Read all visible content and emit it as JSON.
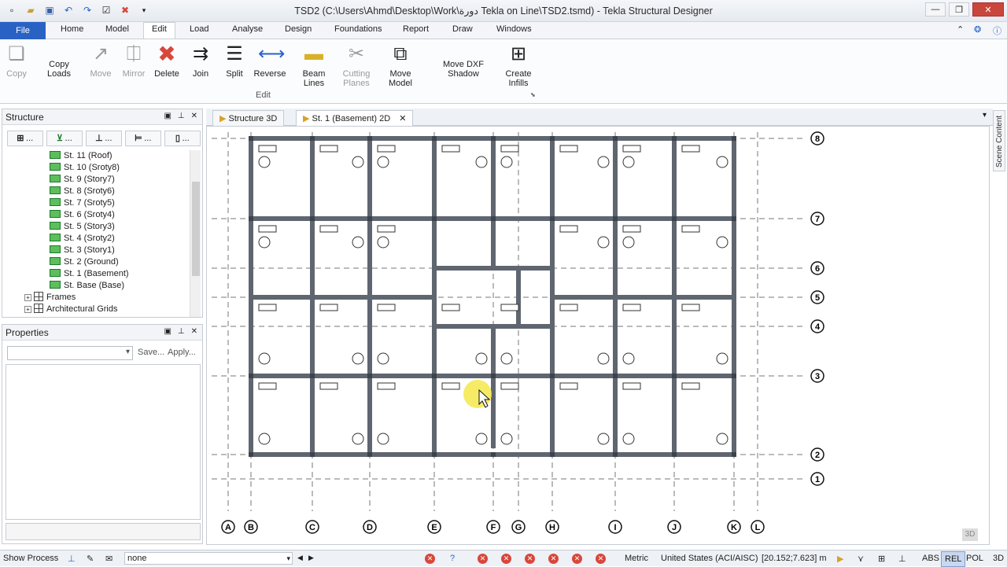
{
  "window": {
    "title": "TSD2 (C:\\Users\\Ahmd\\Desktop\\Work\\دورة Tekla on Line\\TSD2.tsmd) - Tekla Structural Designer"
  },
  "menu": {
    "file": "File",
    "tabs": [
      "Home",
      "Model",
      "Edit",
      "Load",
      "Analyse",
      "Design",
      "Foundations",
      "Report",
      "Draw",
      "Windows"
    ],
    "active_tab": "Edit"
  },
  "ribbon": {
    "copy": "Copy",
    "copy_loads": "Copy Loads",
    "move": "Move",
    "mirror": "Mirror",
    "delete": "Delete",
    "join": "Join",
    "split": "Split",
    "reverse": "Reverse",
    "beam_lines": "Beam Lines",
    "cutting_planes_1": "Cutting",
    "cutting_planes_2": "Planes",
    "move_model": "Move Model",
    "move_dxf_shadow": "Move DXF Shadow",
    "create_infills_1": "Create",
    "create_infills_2": "Infills",
    "group_label": "Edit"
  },
  "structure_panel": {
    "title": "Structure",
    "tree": [
      "St. 11 (Roof)",
      "St. 10 (Sroty8)",
      "St. 9 (Story7)",
      "St. 8 (Sroty6)",
      "St. 7 (Sroty5)",
      "St. 6 (Sroty4)",
      "St. 5 (Story3)",
      "St. 4 (Sroty2)",
      "St. 3 (Story1)",
      "St. 2 (Ground)",
      "St. 1 (Basement)",
      "St. Base (Base)"
    ],
    "frames": "Frames",
    "arch_grids": "Architectural Grids",
    "tab_more": "..."
  },
  "properties_panel": {
    "title": "Properties",
    "save": "Save...",
    "apply": "Apply..."
  },
  "doc_tabs": {
    "tab1": "Structure 3D",
    "tab2": "St. 1 (Basement) 2D"
  },
  "scene_content": "Scene Content",
  "grids": {
    "cols": [
      "A",
      "B",
      "C",
      "D",
      "E",
      "F",
      "G",
      "H",
      "I",
      "J",
      "K",
      "L"
    ],
    "rows": [
      "8",
      "7",
      "6",
      "5",
      "4",
      "3",
      "2",
      "1"
    ]
  },
  "status": {
    "show_process": "Show Process",
    "combo": "none",
    "metric": "Metric",
    "code": "United States (ACI/AISC)",
    "coords": "[20.152;7.623] m",
    "abs": "ABS",
    "rel": "REL",
    "pol": "POL",
    "three_d": "3D",
    "badge": "3D"
  },
  "colors": {
    "file_tab": "#2a62c4",
    "member": "#5f6670",
    "delete": "#d8473b"
  },
  "icons": [
    "new-icon",
    "open-icon",
    "save-icon",
    "undo-icon",
    "redo-icon",
    "check-icon",
    "delete-x-icon"
  ]
}
